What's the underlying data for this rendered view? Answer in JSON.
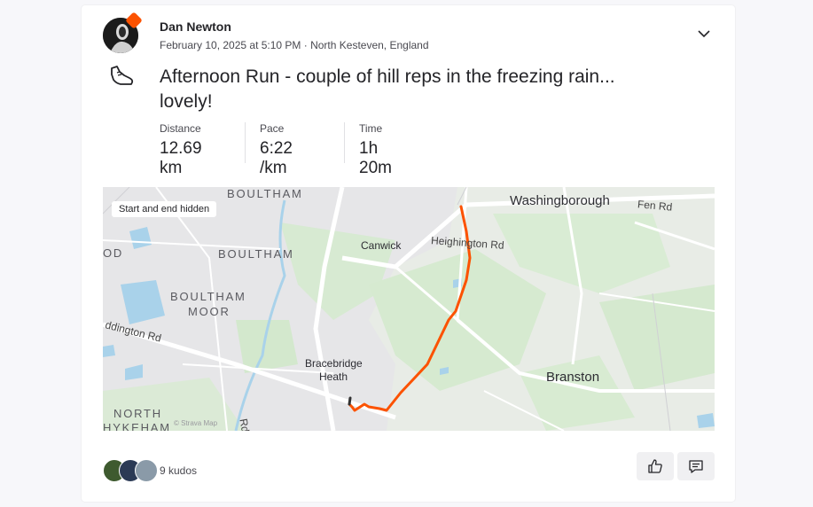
{
  "athlete": {
    "name": "Dan Newton"
  },
  "activity": {
    "meta": "February 10, 2025 at 5:10 PM · North Kesteven, England",
    "title": "Afternoon Run - couple of hill reps in the freezing rain... lovely!",
    "type_icon": "shoe-icon"
  },
  "stats": [
    {
      "label": "Distance",
      "value": "12.69 km"
    },
    {
      "label": "Pace",
      "value": "6:22 /km"
    },
    {
      "label": "Time",
      "value": "1h 20m"
    }
  ],
  "map": {
    "privacy_note": "Start and end hidden",
    "route_color": "#fc5200",
    "places": {
      "boultham_top": "BOULTHAM",
      "boultham": "BOULTHAM",
      "boultham_moor_1": "BOULTHAM",
      "boultham_moor_2": "MOOR",
      "od": "OD",
      "north": "NORTH",
      "hykeham": "HYKEHAM",
      "canwick": "Canwick",
      "washingborough": "Washingborough",
      "bracebridge_1": "Bracebridge",
      "bracebridge_2": "Heath",
      "branston": "Branston"
    },
    "roads": {
      "fen_rd": "Fen Rd",
      "heighington_rd": "Heighington Rd",
      "doddington_rd": "ddington Rd",
      "rd": "Rd"
    },
    "attribution": "© Strava Map"
  },
  "kudos": {
    "text": "9 kudos"
  },
  "actions": {
    "kudos_icon": "thumbs-up-icon",
    "comment_icon": "comment-icon"
  },
  "colors": {
    "accent": "#fc5200",
    "text": "#242428",
    "muted": "#494950"
  }
}
